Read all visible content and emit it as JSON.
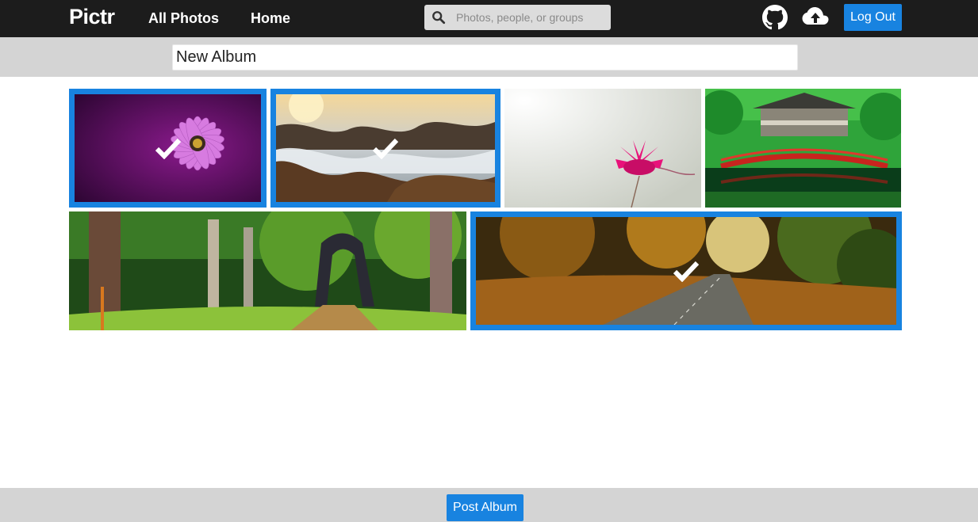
{
  "nav": {
    "logo": "Pictr",
    "links": [
      "All Photos",
      "Home"
    ],
    "search_placeholder": "Photos, people, or groups",
    "logout_label": "Log Out",
    "icons": [
      "search-icon",
      "github-icon",
      "cloud-upload-icon"
    ]
  },
  "album": {
    "title_value": "New Album"
  },
  "photos": [
    {
      "subject": "purple daisy",
      "selected": true
    },
    {
      "subject": "rocky shoreline at sunset",
      "selected": true
    },
    {
      "subject": "pink lotus",
      "selected": false
    },
    {
      "subject": "red bridge temple",
      "selected": false
    },
    {
      "subject": "forest path with arch sculpture",
      "selected": false
    },
    {
      "subject": "autumn road",
      "selected": true
    }
  ],
  "footer": {
    "post_label": "Post Album"
  },
  "colors": {
    "accent": "#1883e0",
    "nav_bg": "#1c1c1c",
    "bar_bg": "#d4d4d4"
  }
}
